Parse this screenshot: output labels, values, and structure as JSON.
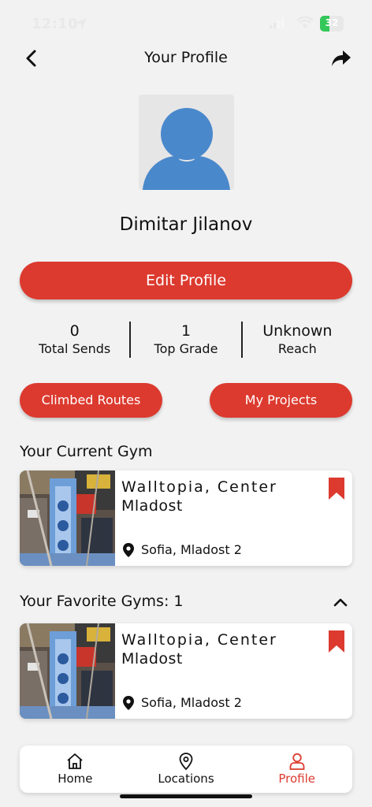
{
  "status_bar": {
    "time": "12:10",
    "battery": "32"
  },
  "header": {
    "title": "Your Profile",
    "back_icon": "chevron-left-icon",
    "share_icon": "share-arrow-icon"
  },
  "profile": {
    "name": "Dimitar Jilanov",
    "edit_label": "Edit Profile"
  },
  "stats": [
    {
      "value": "0",
      "label": "Total Sends"
    },
    {
      "value": "1",
      "label": "Top Grade"
    },
    {
      "value": "Unknown",
      "label": "Reach"
    }
  ],
  "actions": {
    "climbed_routes": "Climbed Routes",
    "my_projects": "My Projects"
  },
  "current_gym": {
    "section_title": "Your Current Gym",
    "name_line1": "Walltopia, Center",
    "name_line2": "Mladost",
    "location": "Sofia, Mladost 2"
  },
  "favorite_gyms": {
    "section_title": "Your Favorite Gyms: 1",
    "items": [
      {
        "name_line1": "Walltopia, Center",
        "name_line2": "Mladost",
        "location": "Sofia, Mladost 2"
      }
    ]
  },
  "nav": {
    "home": "Home",
    "locations": "Locations",
    "profile": "Profile",
    "active": "Profile"
  },
  "colors": {
    "accent": "#dc3a2f",
    "avatar_blue": "#4a88cc",
    "background": "#f2f2f2"
  }
}
